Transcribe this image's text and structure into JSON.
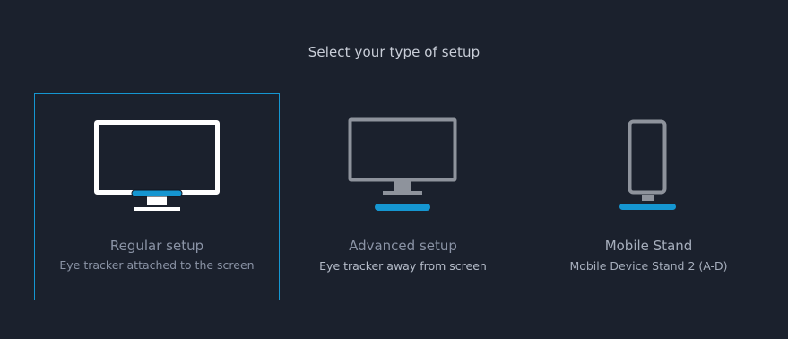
{
  "header": {
    "title": "Select your type of setup"
  },
  "colors": {
    "background": "#1b212d",
    "accent": "#1596d1",
    "selected_icon": "#ffffff",
    "unselected_icon": "#8e939c"
  },
  "options": [
    {
      "id": "regular",
      "label": "Regular setup",
      "description": "Eye tracker attached to the screen",
      "icon": "monitor-with-tracker-icon",
      "selected": true
    },
    {
      "id": "advanced",
      "label": "Advanced setup",
      "description": "Eye tracker away from screen",
      "icon": "monitor-separate-tracker-icon",
      "selected": false
    },
    {
      "id": "mobile",
      "label": "Mobile Stand",
      "description": "Mobile Device Stand 2 (A-D)",
      "icon": "phone-on-stand-icon",
      "selected": false
    }
  ]
}
